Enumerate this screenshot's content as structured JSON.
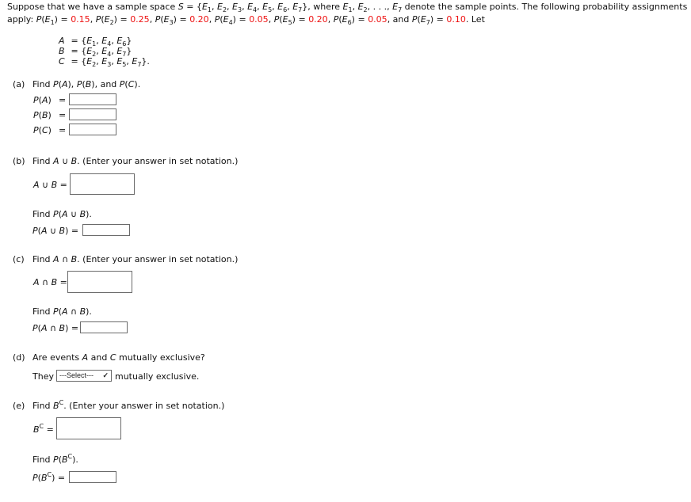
{
  "intro": {
    "line1_prefix": "Suppose that we have a sample space ",
    "sample_space_symbol": "S",
    "sample_space_set": "{E1, E2, E3, E4, E5, E6, E7}",
    "line1_suffix": ", where E1, E2, ..., E7 denote the sample points. The following probability assignments",
    "line2_prefix": "apply: ",
    "line2_suffix": ". Let",
    "probabilities": [
      {
        "event": "E1",
        "value": "0.15"
      },
      {
        "event": "E2",
        "value": "0.25"
      },
      {
        "event": "E3",
        "value": "0.20"
      },
      {
        "event": "E4",
        "value": "0.05"
      },
      {
        "event": "E5",
        "value": "0.20"
      },
      {
        "event": "E6",
        "value": "0.05"
      },
      {
        "event": "E7",
        "value": "0.10"
      }
    ],
    "highlight_color": "#ee1111"
  },
  "sets": [
    {
      "name": "A",
      "elements": [
        "E1",
        "E4",
        "E6"
      ],
      "end": ""
    },
    {
      "name": "B",
      "elements": [
        "E2",
        "E4",
        "E7"
      ],
      "end": ""
    },
    {
      "name": "C",
      "elements": [
        "E2",
        "E3",
        "E5",
        "E7"
      ],
      "end": "."
    }
  ],
  "parts": {
    "a": {
      "label": "(a)",
      "question": "Find P(A), P(B), and P(C).",
      "answers": [
        {
          "label": "P(A)",
          "eq": "=",
          "value": ""
        },
        {
          "label": "P(B)",
          "eq": "=",
          "value": ""
        },
        {
          "label": "P(C)",
          "eq": "=",
          "value": ""
        }
      ]
    },
    "b": {
      "label": "(b)",
      "question_prefix": "Find ",
      "question_expr": "A ∪ B",
      "question_suffix": ". (Enter your answer in set notation.)",
      "set_answer_label": "A ∪ B =",
      "set_answer_value": "",
      "prob_question": "Find P(A ∪ B).",
      "prob_answer_label": "P(A ∪ B) =",
      "prob_answer_value": ""
    },
    "c": {
      "label": "(c)",
      "question_prefix": "Find ",
      "question_expr": "A ∩ B",
      "question_suffix": ". (Enter your answer in set notation.)",
      "set_answer_label": "A ∩ B =",
      "set_answer_value": "",
      "prob_question": "Find P(A ∩ B).",
      "prob_answer_label": "P(A ∩ B) =",
      "prob_answer_value": ""
    },
    "d": {
      "label": "(d)",
      "question": "Are events A and C mutually exclusive?",
      "sentence_prefix": "They",
      "select_value": "---Select---",
      "sentence_suffix": "mutually exclusive."
    },
    "e": {
      "label": "(e)",
      "question_prefix": "Find ",
      "question_suffix": ". (Enter your answer in set notation.)",
      "complement_base": "B",
      "complement_sup": "C",
      "set_answer_value": "",
      "prob_question_prefix": "Find P(",
      "prob_question_suffix": ").",
      "prob_answer_prefix": "P(",
      "prob_answer_suffix": ") =",
      "prob_answer_value": ""
    }
  }
}
